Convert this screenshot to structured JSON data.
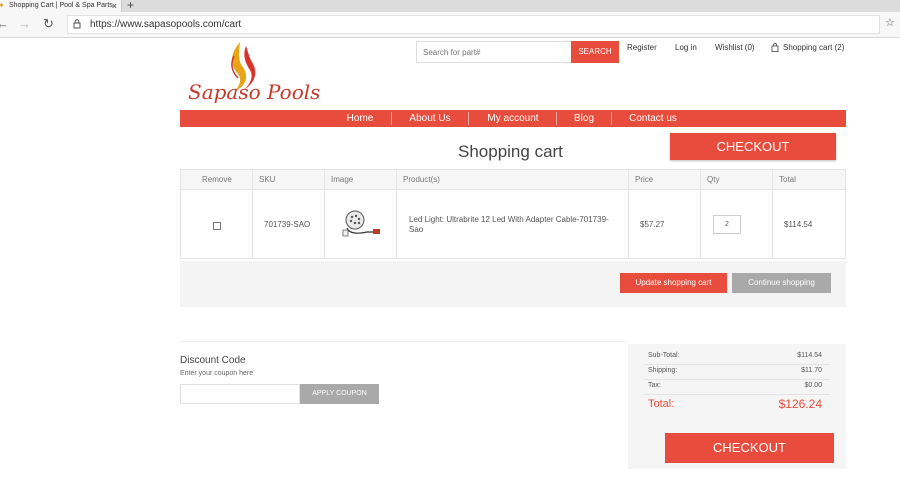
{
  "browser": {
    "tab_title": "Shopping Cart | Pool & Spa Parts",
    "tab_close": "×",
    "new_tab": "+",
    "url": "https://www.sapasopools.com/cart",
    "icons": [
      "back-icon",
      "forward-icon",
      "reload-icon",
      "lock-icon",
      "star-icon"
    ]
  },
  "header": {
    "logo_text": "Sapaso Pools",
    "search_placeholder": "Search for part#",
    "search_button": "SEARCH",
    "links": {
      "register": "Register",
      "login": "Log in",
      "wishlist": "Wishlist (0)",
      "cart": "Shopping cart (2)"
    }
  },
  "nav": [
    "Home",
    "About Us",
    "My account",
    "Blog",
    "Contact us"
  ],
  "page": {
    "title": "Shopping cart",
    "checkout": "CHECKOUT"
  },
  "table": {
    "headers": [
      "Remove",
      "SKU",
      "Image",
      "Product(s)",
      "Price",
      "Qty",
      "Total"
    ],
    "row": {
      "sku": "701739-SAO",
      "product_line1": "Led Light: Ultrabrite 12 Led With Adapter Cable-701739-",
      "product_line2": "Sao",
      "price": "$57.27",
      "qty": "2",
      "total": "$114.54"
    }
  },
  "cart_actions": {
    "update": "Update shopping cart",
    "continue": "Continue shopping"
  },
  "discount": {
    "title": "Discount Code",
    "hint": "Enter your coupon here",
    "button": "APPLY COUPON"
  },
  "totals": {
    "subtotal_label": "Sub-Total:",
    "subtotal": "$114.54",
    "shipping_label": "Shipping:",
    "shipping": "$11.70",
    "tax_label": "Tax:",
    "tax": "$0.00",
    "total_label": "Total:",
    "total": "$126.24",
    "checkout": "CHECKOUT"
  },
  "colors": {
    "accent": "#e84c3d",
    "muted_button": "#a9a9a9"
  }
}
